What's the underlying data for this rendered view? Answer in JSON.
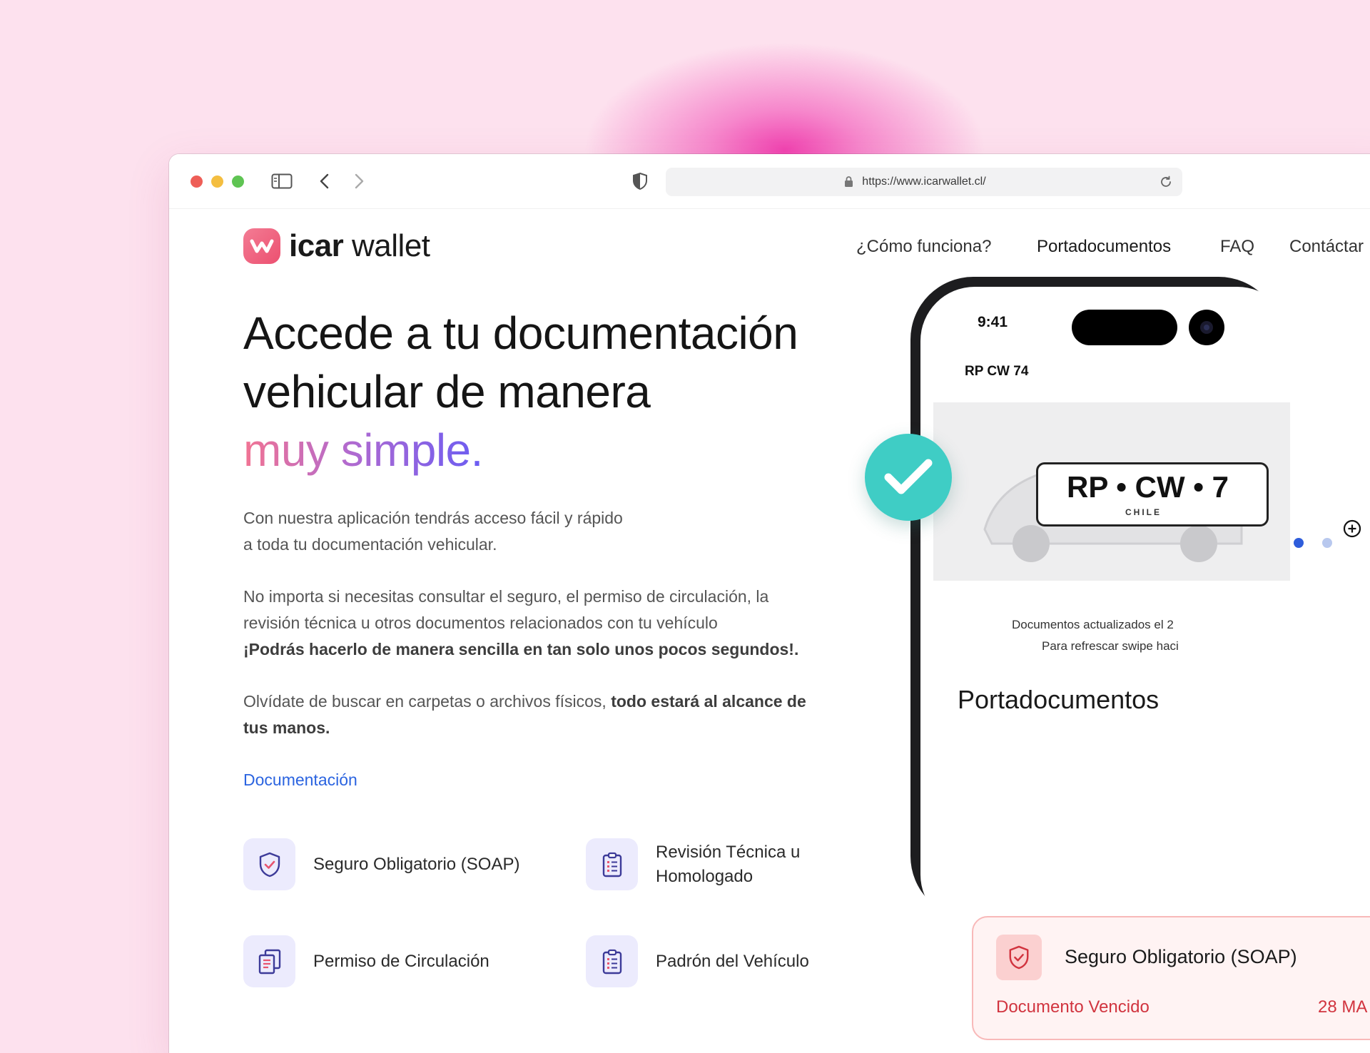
{
  "browser": {
    "url": "https://www.icarwallet.cl/"
  },
  "brand": {
    "name_bold": "icar",
    "name_light": "wallet",
    "accent": "#ec5070"
  },
  "nav": {
    "items": [
      {
        "label": "¿Cómo funciona?"
      },
      {
        "label": "Portadocumentos"
      },
      {
        "label": "FAQ"
      },
      {
        "label": "Contáctar"
      }
    ]
  },
  "hero": {
    "line1": "Accede a tu documentación",
    "line2": "vehicular de manera",
    "line3": "muy simple.",
    "intro_1": "Con nuestra aplicación tendrás acceso fácil y rápido",
    "intro_2": "a toda tu documentación vehicular.",
    "p2_1": "No importa si necesitas consultar el seguro, el permiso de circulación, la",
    "p2_2": "revisión técnica u otros documentos relacionados con tu vehículo",
    "p2_bold": "¡Podrás hacerlo de manera sencilla en tan solo unos pocos segundos!.",
    "p3_a": "Olvídate de buscar en carpetas o archivos físicos, ",
    "p3_bold_1": "todo estará al alcance de",
    "p3_bold_2": "tus manos.",
    "doc_link": "Documentación"
  },
  "features": [
    {
      "label": "Seguro Obligatorio (SOAP)",
      "icon": "shield-check-icon"
    },
    {
      "label_1": "Revisión Técnica u",
      "label_2": "Homologado",
      "icon": "clipboard-list-icon"
    },
    {
      "label": "Permiso de Circulación",
      "icon": "documents-icon"
    },
    {
      "label": "Padrón del Vehículo",
      "icon": "clipboard-list-icon"
    }
  ],
  "phone": {
    "time": "9:41",
    "plate_id": "RP CW 74",
    "plate_text": "RP • CW • 7",
    "plate_country": "CHILE",
    "updated_1": "Documentos actualizados el 2",
    "updated_2": "Para refrescar swipe haci",
    "section_title": "Portadocumentos"
  },
  "doc_card": {
    "title": "Seguro Obligatorio (SOAP)",
    "status": "Documento Vencido",
    "date": "28 MA",
    "status_color": "#d1343f"
  }
}
